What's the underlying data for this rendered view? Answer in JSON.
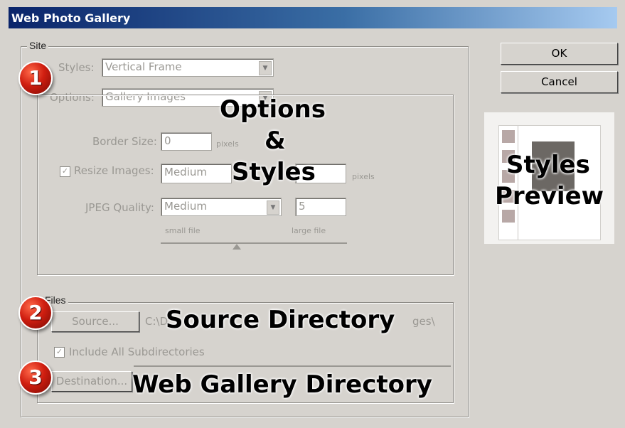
{
  "window": {
    "title": "Web Photo Gallery"
  },
  "site": {
    "legend": "Site",
    "styles_label": "Styles:",
    "styles_value": "Vertical Frame",
    "options_label": "Options:",
    "options_value": "Gallery Images",
    "border_size_label": "Border Size:",
    "border_size_value": "0",
    "border_size_unit": "pixels",
    "resize_label": "Resize Images:",
    "resize_checked": "✓",
    "resize_value": "Medium",
    "resize_unit": "pixels",
    "jpeg_label": "JPEG Quality:",
    "jpeg_value": "Medium",
    "jpeg_number": "5",
    "small_file": "small file",
    "large_file": "large file"
  },
  "files": {
    "legend": "Files",
    "source_button": "Source...",
    "source_path_start": "C:\\D",
    "source_path_end": "ges\\",
    "include_label": "Include All Subdirectories",
    "include_checked": "✓",
    "destination_button": "Destination..."
  },
  "buttons": {
    "ok": "OK",
    "cancel": "Cancel"
  },
  "annotations": {
    "badge1": "1",
    "badge2": "2",
    "badge3": "3",
    "options_line1": "Options",
    "options_line2": "&",
    "options_line3": "Styles",
    "styles_preview_line1": "Styles",
    "styles_preview_line2": "Preview",
    "source_directory": "Source Directory",
    "web_gallery_directory": "Web Gallery Directory"
  },
  "icons": {
    "dropdown": "chevron-down-icon",
    "checkbox": "checkmark-icon"
  },
  "colors": {
    "titlebar_start": "#0a246a",
    "titlebar_end": "#a6caf0",
    "badge": "#d01e10",
    "dialog_bg": "#d6d3ce"
  }
}
